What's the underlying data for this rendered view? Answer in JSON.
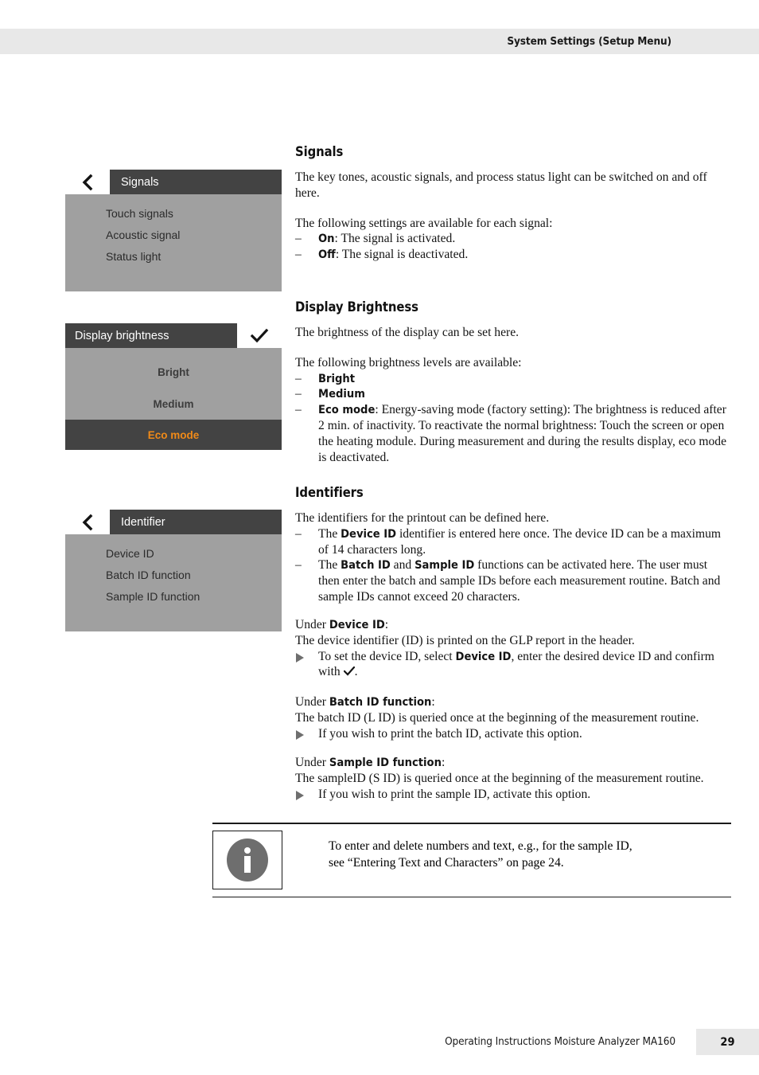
{
  "header": {
    "running_head": "System Settings (Setup Menu)"
  },
  "device_panels": {
    "signals": {
      "title": "Signals",
      "back_icon": "chevron-left-icon",
      "items": [
        "Touch signals",
        "Acoustic signal",
        "Status light"
      ]
    },
    "brightness": {
      "title": "Display brightness",
      "confirm_icon": "check-icon",
      "options": [
        "Bright",
        "Medium",
        "Eco mode"
      ],
      "selected": "Eco mode",
      "selected_color": "#f08a18",
      "bar_color": "#434343",
      "body_color": "#a0a0a0"
    },
    "identifier": {
      "title": "Identifier",
      "back_icon": "chevron-left-icon",
      "items": [
        "Device ID",
        "Batch ID function",
        "Sample ID function"
      ]
    }
  },
  "sections": {
    "signals": {
      "title": "Signals",
      "intro": "The key tones, acoustic signals, and process status light can be switched on and off here.",
      "lead": "The following settings are available for each signal:",
      "items": [
        {
          "term": "On",
          "rest": ": The signal is activated."
        },
        {
          "term": "Off",
          "rest": ": The signal is deactivated."
        }
      ]
    },
    "brightness": {
      "title": "Display Brightness",
      "intro": "The brightness of the display can be set here.",
      "lead": "The following brightness levels are available:",
      "items": [
        {
          "term": "Bright",
          "rest": ""
        },
        {
          "term": "Medium",
          "rest": ""
        },
        {
          "term": "Eco mode",
          "rest": ": Energy-saving mode (factory setting): The brightness is reduced after 2 min. of inactivity. To reactivate the normal brightness: Touch the screen or open the heating module. During measurement and during the results display, eco mode is deactivated."
        }
      ]
    },
    "identifiers": {
      "title": "Identifiers",
      "intro": "The identifiers for the printout can be defined here.",
      "item1_a": "The ",
      "item1_b": "Device ID",
      "item1_c": " identifier is entered here once. The device ID can be a maximum of 14 characters long.",
      "item2_a": "The ",
      "item2_b": "Batch ID",
      "item2_c": " and ",
      "item2_d": "Sample ID",
      "item2_e": " functions can be activated here. The user must then enter the batch and sample IDs before each measurement routine. Batch and sample IDs cannot exceed 20 characters."
    },
    "under_device": {
      "label_pre": "Under ",
      "label_term": "Device ID",
      "label_post": ":",
      "line": "The device identifier (ID) is printed on the GLP report in the header.",
      "action_a": "To set the device ID, select ",
      "action_b": "Device ID",
      "action_c": ", enter the desired device ID and confirm with ",
      "action_icon": "check-icon",
      "action_d": "."
    },
    "under_batch": {
      "label_pre": "Under ",
      "label_term": "Batch ID function",
      "label_post": ":",
      "line": "The batch ID (L ID) is queried once at the beginning of the measurement routine.",
      "action": "If you wish to print the batch ID, activate this option."
    },
    "under_sample": {
      "label_pre": "Under ",
      "label_term": "Sample ID function",
      "label_post": ":",
      "line": "The sampleID (S ID) is queried once at the beginning of the measurement routine.",
      "action": "If you wish to print the sample ID, activate this option."
    }
  },
  "note": {
    "icon": "info-icon",
    "line1": "To enter and delete numbers and text, e.g., for the sample ID,",
    "line2": "see “Entering Text and Characters” on page 24."
  },
  "footer": {
    "text": "Operating Instructions Moisture Analyzer MA160",
    "page_number": "29"
  }
}
